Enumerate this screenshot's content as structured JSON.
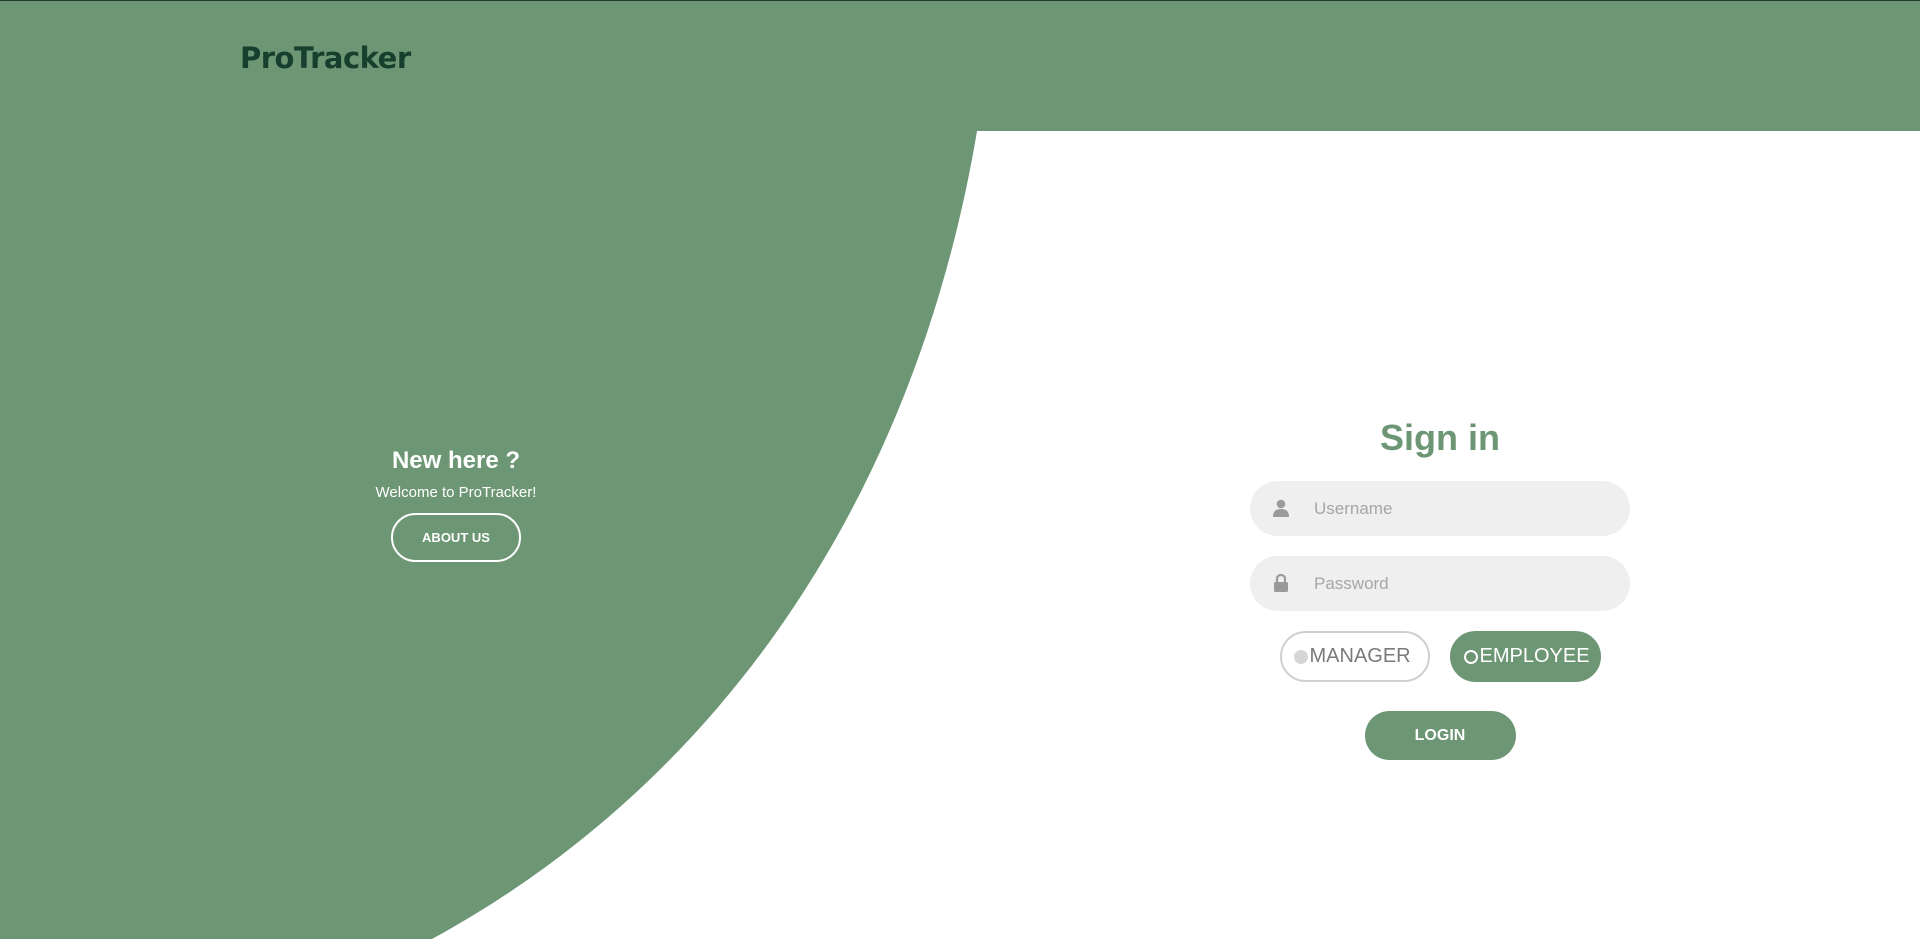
{
  "theme": {
    "accent": "#6d9675",
    "brand_color": "#173f2d"
  },
  "brand": {
    "name": "ProTracker"
  },
  "left_panel": {
    "heading": "New here ?",
    "subtitle": "Welcome to ProTracker!",
    "about_button": "ABOUT US"
  },
  "signin": {
    "title": "Sign in",
    "username": {
      "icon": "user-icon",
      "placeholder": "Username",
      "value": ""
    },
    "password": {
      "icon": "lock-icon",
      "placeholder": "Password",
      "value": ""
    },
    "roles": [
      {
        "label": "MANAGER",
        "selected": false
      },
      {
        "label": "EMPLOYEE",
        "selected": true
      }
    ],
    "login_button": "LOGIN"
  }
}
